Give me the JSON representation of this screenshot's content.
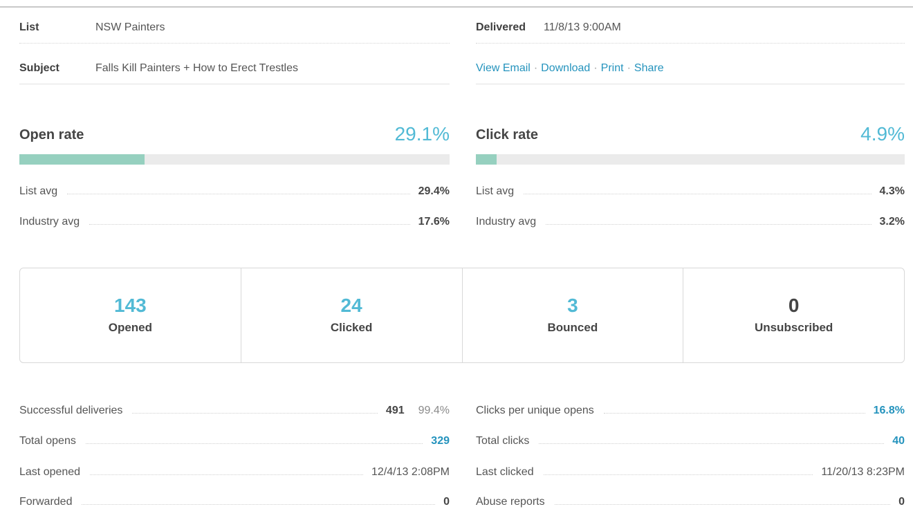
{
  "meta": {
    "list_label": "List",
    "list_value": "NSW Painters",
    "subject_label": "Subject",
    "subject_value": "Falls Kill Painters + How to Erect Trestles",
    "delivered_label": "Delivered",
    "delivered_value": "11/8/13 9:00AM",
    "links": {
      "view_email": "View Email",
      "download": "Download",
      "print": "Print",
      "share": "Share",
      "separator": "·"
    }
  },
  "open_rate": {
    "title": "Open rate",
    "value": "29.1%",
    "fill_percent": 29.1,
    "list_avg_label": "List avg",
    "list_avg_value": "29.4%",
    "industry_avg_label": "Industry avg",
    "industry_avg_value": "17.6%"
  },
  "click_rate": {
    "title": "Click rate",
    "value": "4.9%",
    "fill_percent": 4.9,
    "list_avg_label": "List avg",
    "list_avg_value": "4.3%",
    "industry_avg_label": "Industry avg",
    "industry_avg_value": "3.2%"
  },
  "stats": {
    "opened": {
      "value": "143",
      "label": "Opened"
    },
    "clicked": {
      "value": "24",
      "label": "Clicked"
    },
    "bounced": {
      "value": "3",
      "label": "Bounced"
    },
    "unsubscribed": {
      "value": "0",
      "label": "Unsubscribed"
    }
  },
  "details_left": {
    "successful_deliveries_label": "Successful deliveries",
    "successful_deliveries_value": "491",
    "successful_deliveries_percent": "99.4%",
    "total_opens_label": "Total opens",
    "total_opens_value": "329",
    "last_opened_label": "Last opened",
    "last_opened_value": "12/4/13 2:08PM",
    "forwarded_label": "Forwarded",
    "forwarded_value": "0"
  },
  "details_right": {
    "clicks_per_unique_label": "Clicks per unique opens",
    "clicks_per_unique_value": "16.8%",
    "total_clicks_label": "Total clicks",
    "total_clicks_value": "40",
    "last_clicked_label": "Last clicked",
    "last_clicked_value": "11/20/13 8:23PM",
    "abuse_reports_label": "Abuse reports",
    "abuse_reports_value": "0"
  },
  "colors": {
    "accent_blue": "#52bad5",
    "link_blue": "#2493bd",
    "bar_fill": "#96d0bf",
    "bar_track": "#ebebeb"
  }
}
